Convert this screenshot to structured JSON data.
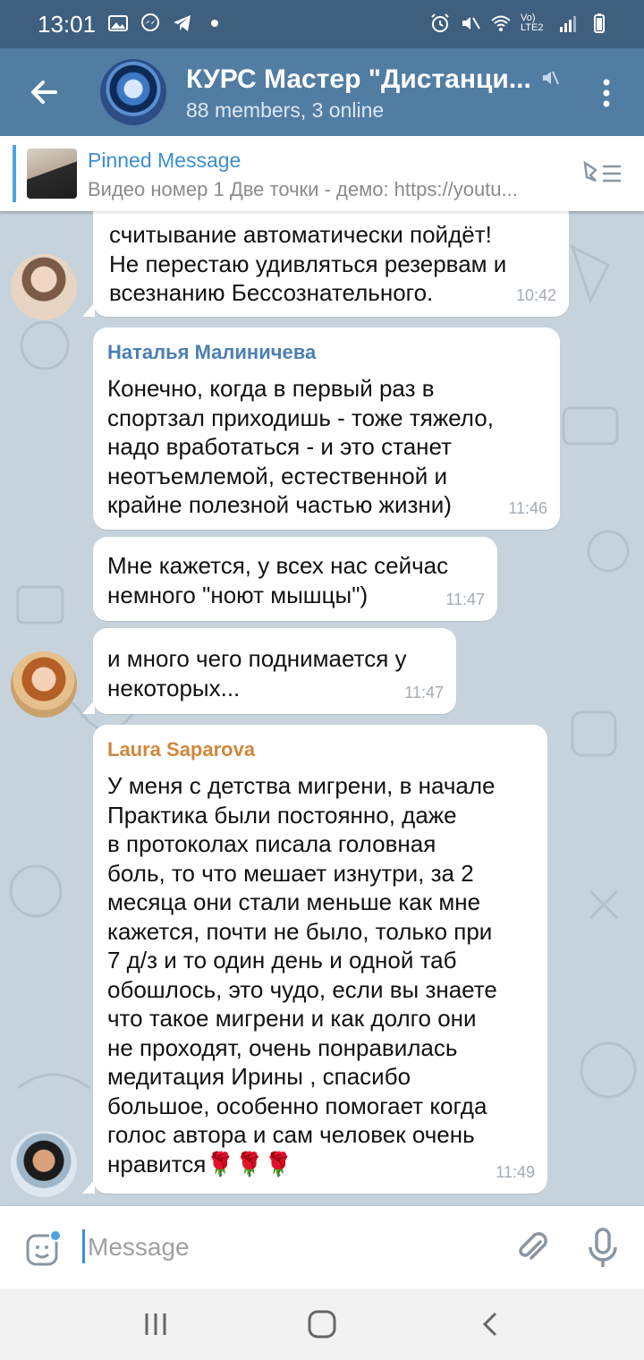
{
  "status_bar": {
    "time": "13:01",
    "left_icons": [
      "gallery-icon",
      "messenger-icon",
      "telegram-icon",
      "dot-icon"
    ],
    "right_icons": [
      "alarm-icon",
      "mute-icon",
      "wifi-icon",
      "signal-icon",
      "battery-icon"
    ],
    "lte_label": "Vo) LTE2"
  },
  "header": {
    "title": "КУРС Мастер \"Дистанци...",
    "subtitle": "88 members, 3 online"
  },
  "pinned": {
    "title": "Pinned Message",
    "text": "Видео номер 1 Две точки - демо: https://youtu..."
  },
  "messages": [
    {
      "text": "считывание автоматически пойдёт!\nНе перестаю удивляться резервам и\nвсезнанию Бессознательного.",
      "time": "10:42"
    },
    {
      "sender": "Наталья Малиничева",
      "sender_color": "#4b7fb5",
      "text": "Конечно, когда в первый раз в\nспортзал приходишь - тоже тяжело,\nнадо вработаться - и это станет\nнеотъемлемой, естественной и\nкрайне полезной частью жизни)",
      "time": "11:46"
    },
    {
      "text": "Мне кажется, у всех нас сейчас\nнемного \"ноют мышцы\")",
      "time": "11:47"
    },
    {
      "text": "и много чего поднимается у\nнекоторых...",
      "time": "11:47"
    },
    {
      "sender": "Laura Saparova",
      "sender_color": "#d1873c",
      "text": "У меня с детства мигрени, в начале\nПрактика были постоянно, даже\nв протоколах писала головная\nболь, то что мешает изнутри, за 2\nмесяца они стали меньше как мне\nкажется, почти не было, только при\n7 д/з и то один день и одной таб\nобошлось, это чудо, если вы знаете\nчто такое мигрени и как долго они\nне проходят, очень понравилась\nмедитация Ирины , спасибо\nбольшое, особенно помогает когда\nголос автора и сам человек очень\nнравится🌹🌹🌹",
      "time": "11:49"
    }
  ],
  "composer": {
    "placeholder": "Message"
  },
  "colors": {
    "header_bg": "#527da3",
    "status_bg": "#3f5f7f",
    "chat_bg": "#c6d3dd",
    "accent": "#3c8ed2"
  }
}
